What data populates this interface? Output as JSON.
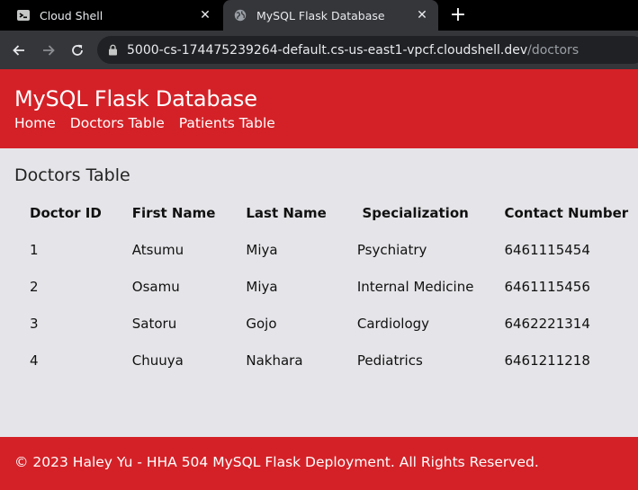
{
  "browser": {
    "tabs": [
      {
        "title": "Cloud Shell",
        "icon": "cloud-shell-icon",
        "active": false
      },
      {
        "title": "MySQL Flask Database",
        "icon": "globe-icon",
        "active": true
      }
    ],
    "address": {
      "host": "5000-cs-174475239264-default.cs-us-east1-vpcf.cloudshell.dev",
      "path": "/doctors"
    }
  },
  "site": {
    "title": "MySQL Flask Database",
    "nav": [
      "Home",
      "Doctors Table",
      "Patients Table"
    ],
    "accent_color": "#d42127"
  },
  "main": {
    "heading": "Doctors Table",
    "table": {
      "columns": [
        "Doctor ID",
        "First Name",
        "Last Name",
        "Specialization",
        "Contact Number"
      ],
      "rows": [
        [
          "1",
          "Atsumu",
          "Miya",
          "Psychiatry",
          "6461115454"
        ],
        [
          "2",
          "Osamu",
          "Miya",
          "Internal Medicine",
          "6461115456"
        ],
        [
          "3",
          "Satoru",
          "Gojo",
          "Cardiology",
          "6462221314"
        ],
        [
          "4",
          "Chuuya",
          "Nakhara",
          "Pediatrics",
          "6461211218"
        ]
      ]
    }
  },
  "footer": {
    "text": "© 2023 Haley Yu - HHA 504 MySQL Flask Deployment. All Rights Reserved."
  }
}
